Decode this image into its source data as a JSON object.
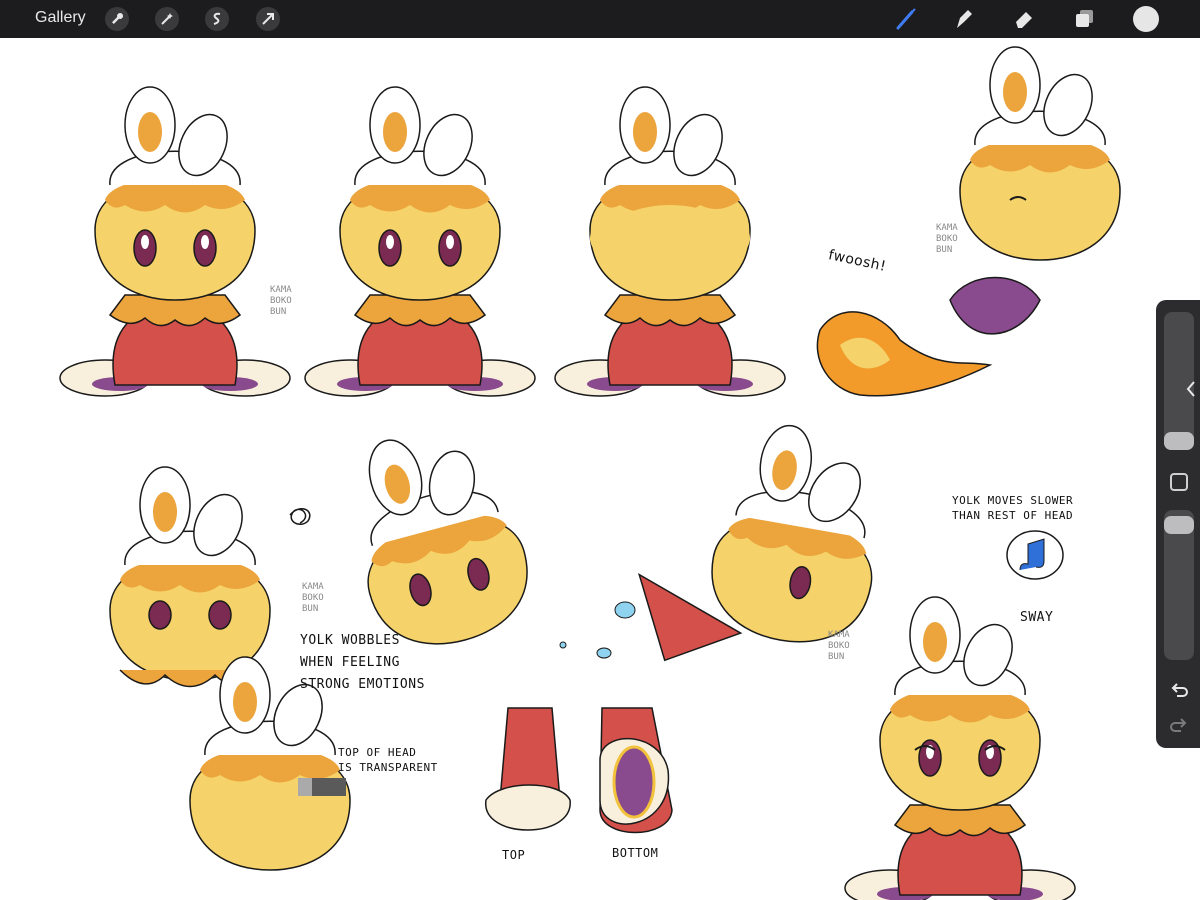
{
  "topbar": {
    "gallery_label": "Gallery",
    "left_tools": [
      "wrench-icon",
      "magic-wand-icon",
      "selection-icon",
      "transform-arrow-icon"
    ],
    "right_tools": [
      "brush-icon",
      "smudge-icon",
      "eraser-icon",
      "layers-icon"
    ],
    "active_tool": "brush-icon",
    "active_color": "#e6e6e6",
    "accent_color": "#3f7cf2"
  },
  "canvas": {
    "annotations": {
      "sound_effect": "fwoosh!",
      "yolk_wobbles": "YOLK WOBBLES\nWHEN FEELING\nSTRONG EMOTIONS",
      "yolk_moves": "YOLK MOVES SLOWER\nTHAN REST OF HEAD",
      "sway": "SWAY",
      "top_of_head": "TOP OF HEAD\nIS TRANSPARENT",
      "feet_top": "TOP",
      "feet_bottom": "BOTTOM"
    },
    "signatures": [
      "KAMA\nBOKO\nBUN",
      "KAMA\nBOKO\nBUN",
      "KAMA\nBOKO\nBUN",
      "KAMA\nBOKO\nBUN"
    ],
    "palette": {
      "yolk": "#f5d36a",
      "yolk_dark": "#eca43c",
      "body_red": "#d4504a",
      "foot_purple": "#8a4a8e",
      "eye": "#7b2a52",
      "outline": "#1a1a1a"
    }
  },
  "sidebar": {
    "brush_size_level": 0.0,
    "opacity_level": 0.0,
    "icons": [
      "collapse-chevron-icon",
      "modify-square-icon",
      "undo-icon",
      "redo-icon"
    ]
  }
}
